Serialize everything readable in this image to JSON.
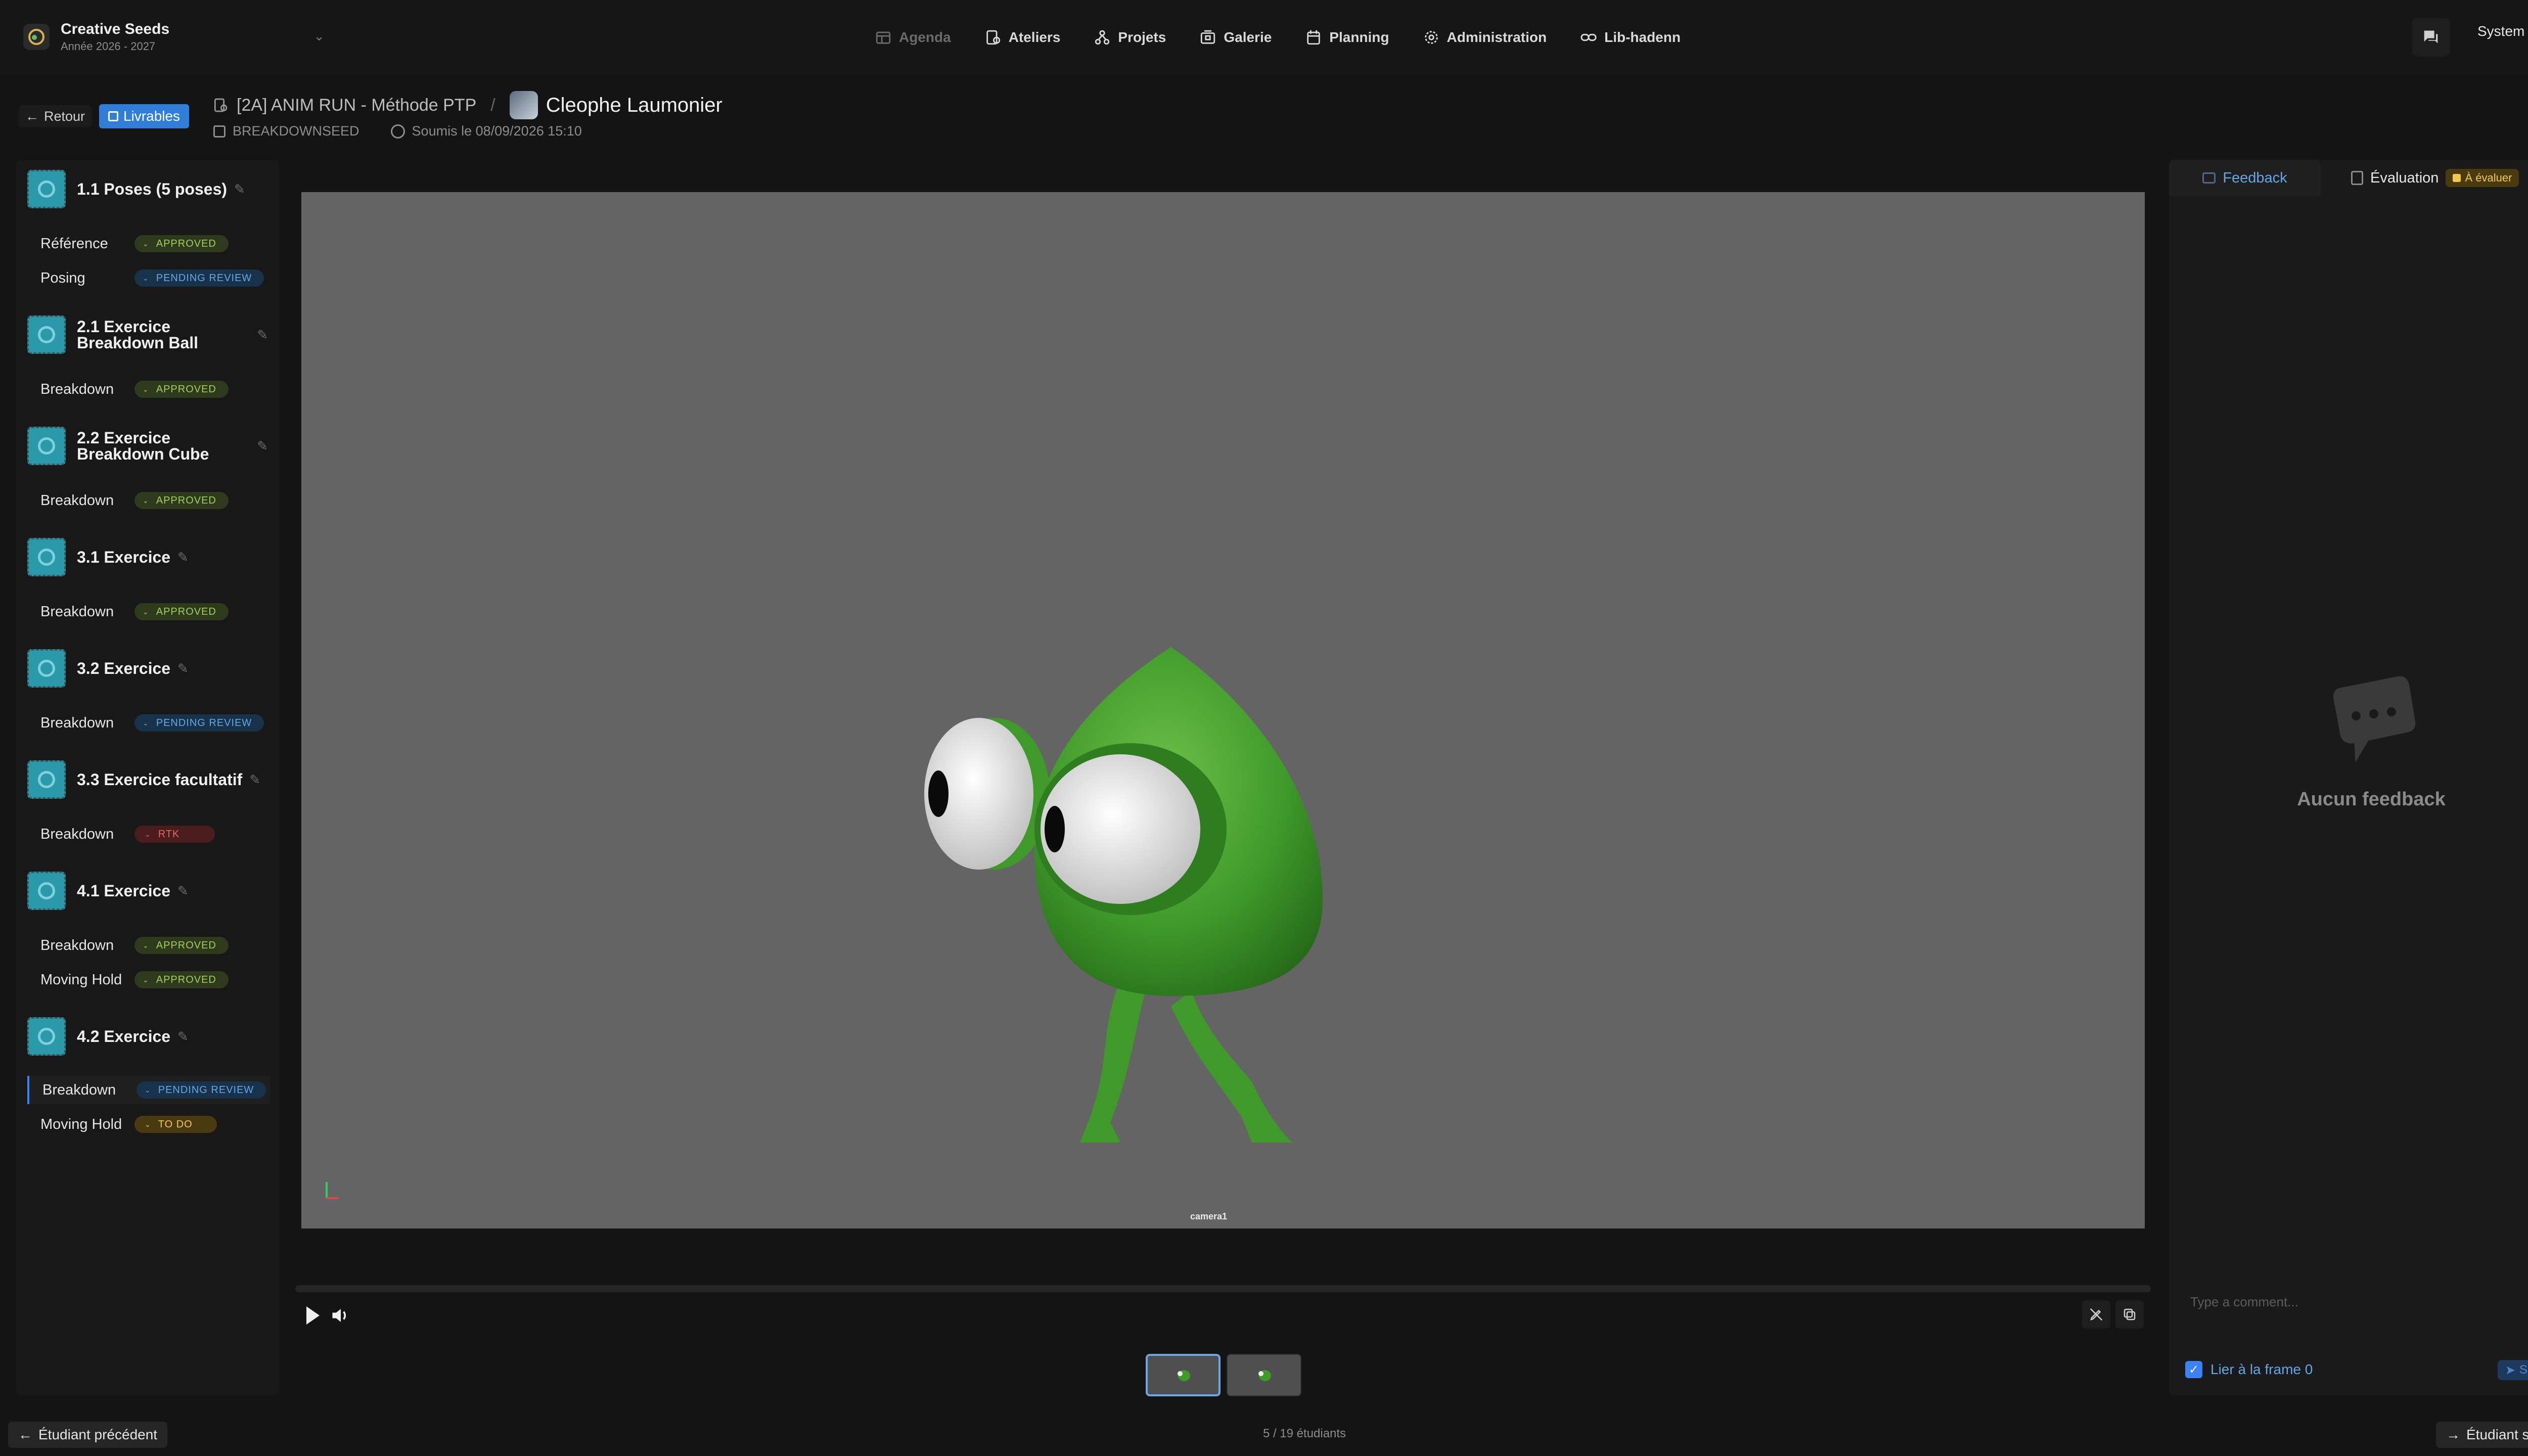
{
  "workspace": {
    "name": "Creative Seeds",
    "year": "Année 2026 - 2027"
  },
  "nav": [
    {
      "label": "Agenda",
      "icon": "calendar-grid-icon"
    },
    {
      "label": "Ateliers",
      "icon": "workshop-icon"
    },
    {
      "label": "Projets",
      "icon": "projects-icon"
    },
    {
      "label": "Galerie",
      "icon": "gallery-icon"
    },
    {
      "label": "Planning",
      "icon": "planning-icon"
    },
    {
      "label": "Administration",
      "icon": "gear-icon"
    },
    {
      "label": "Lib-hadenn",
      "icon": "link-icon"
    }
  ],
  "user": {
    "name": "System"
  },
  "header": {
    "back_label": "Retour",
    "deliverables_label": "Livrables",
    "course": "[2A] ANIM RUN - Méthode PTP",
    "student": "Cleophe Laumonier",
    "category": "BREAKDOWNSEED",
    "submitted": "Soumis le 08/09/2026 15:10"
  },
  "sidebar": {
    "groups": [
      {
        "title": "1.1 Poses (5 poses)",
        "items": [
          {
            "label": "Référence",
            "status": "APPROVED"
          },
          {
            "label": "Posing",
            "status": "PENDING REVIEW"
          }
        ]
      },
      {
        "title": "2.1 Exercice Breakdown Ball",
        "items": [
          {
            "label": "Breakdown",
            "status": "APPROVED"
          }
        ]
      },
      {
        "title": "2.2 Exercice Breakdown Cube",
        "items": [
          {
            "label": "Breakdown",
            "status": "APPROVED"
          }
        ]
      },
      {
        "title": "3.1 Exercice",
        "items": [
          {
            "label": "Breakdown",
            "status": "APPROVED"
          }
        ]
      },
      {
        "title": "3.2 Exercice",
        "items": [
          {
            "label": "Breakdown",
            "status": "PENDING REVIEW"
          }
        ]
      },
      {
        "title": "3.3 Exercice facultatif",
        "items": [
          {
            "label": "Breakdown",
            "status": "RTK"
          }
        ]
      },
      {
        "title": "4.1 Exercice",
        "items": [
          {
            "label": "Breakdown",
            "status": "APPROVED"
          },
          {
            "label": "Moving Hold",
            "status": "APPROVED"
          }
        ]
      },
      {
        "title": "4.2 Exercice",
        "items": [
          {
            "label": "Breakdown",
            "status": "PENDING REVIEW"
          },
          {
            "label": "Moving Hold",
            "status": "TO DO"
          }
        ]
      }
    ]
  },
  "viewer": {
    "camera_label": "camera1"
  },
  "feedback": {
    "tab_feedback": "Feedback",
    "tab_evaluation": "Évaluation",
    "evaluation_badge": "À évaluer",
    "empty_text": "Aucun feedback",
    "comment_placeholder": "Type a comment...",
    "link_frame_label": "Lier à la frame 0",
    "send_label": "Send"
  },
  "footer": {
    "prev_label": "Étudiant précédent",
    "counter": "5 / 19 étudiants",
    "next_label": "Étudiant suivant"
  },
  "colors": {
    "accent": "#3b82f6",
    "approved": "#9fd15c",
    "pending": "#62a8e8",
    "rtk": "#e06a6a",
    "todo": "#f2c94c"
  }
}
